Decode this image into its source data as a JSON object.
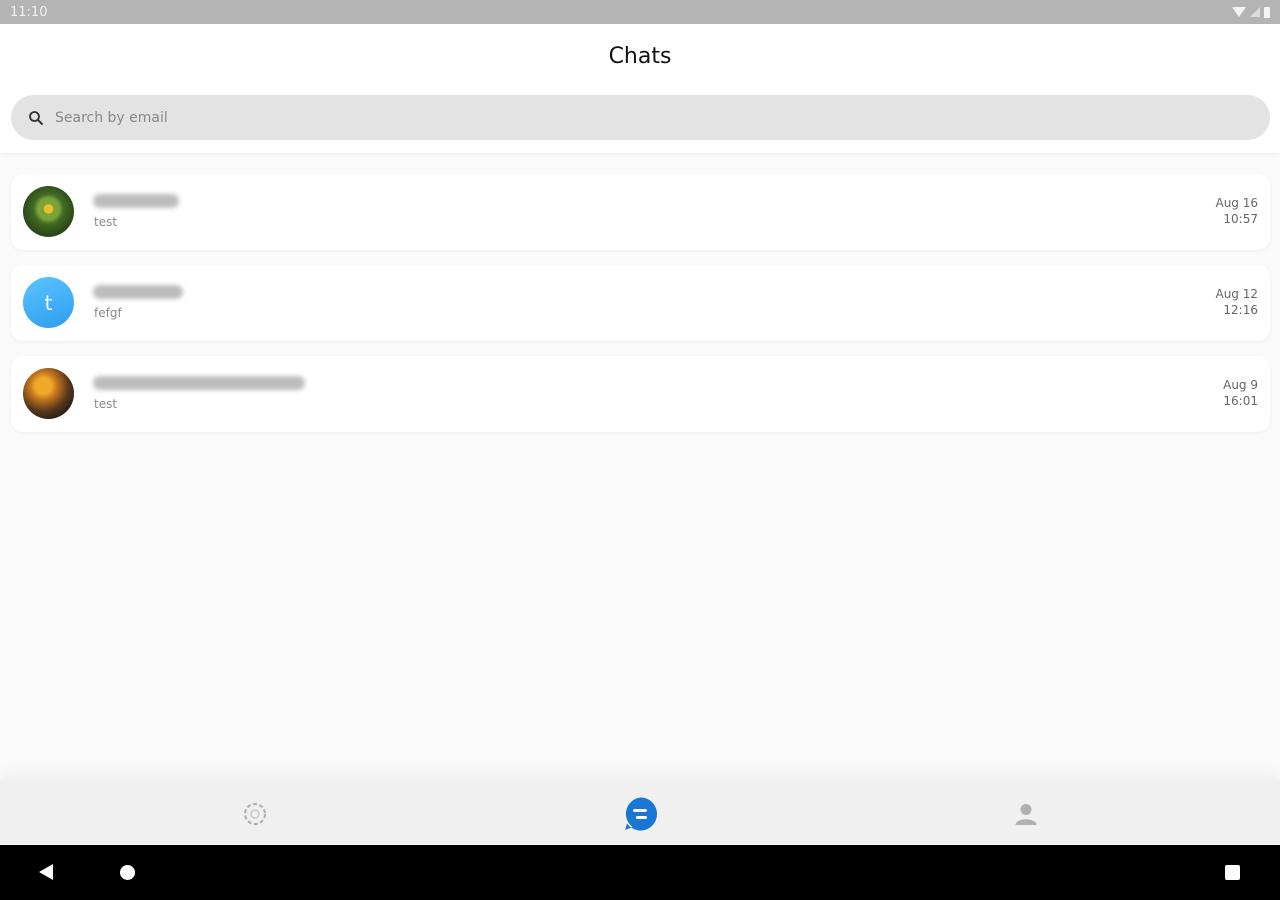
{
  "status_bar": {
    "time": "11:10",
    "icons": [
      "wifi-icon",
      "signal-icon",
      "battery-icon"
    ]
  },
  "header": {
    "title": "Chats"
  },
  "search": {
    "placeholder": "Search by email",
    "value": ""
  },
  "chats": [
    {
      "name": "",
      "name_obscured": true,
      "preview": "test",
      "date": "Aug 16",
      "time": "10:57",
      "avatar": "photo"
    },
    {
      "name": "",
      "name_obscured": true,
      "preview": "fefgf",
      "date": "Aug 12",
      "time": "12:16",
      "avatar": "letter",
      "avatar_letter": "t"
    },
    {
      "name": "",
      "name_obscured": true,
      "preview": "test",
      "date": "Aug 9",
      "time": "16:01",
      "avatar": "photo"
    }
  ],
  "bottom_nav": {
    "items": [
      {
        "icon": "stories-icon",
        "active": false
      },
      {
        "icon": "chat-bubble-icon",
        "active": true
      },
      {
        "icon": "person-icon",
        "active": false
      }
    ]
  },
  "system_nav": {
    "icons": [
      "back-icon",
      "home-icon",
      "recents-icon"
    ]
  },
  "colors": {
    "accent": "#1976d2",
    "avatar_letter_bg": "#2d9cf0",
    "search_bg": "#e3e3e3",
    "status_bar_bg": "#b4b4b4",
    "inactive_icon": "#b0b0b0"
  }
}
